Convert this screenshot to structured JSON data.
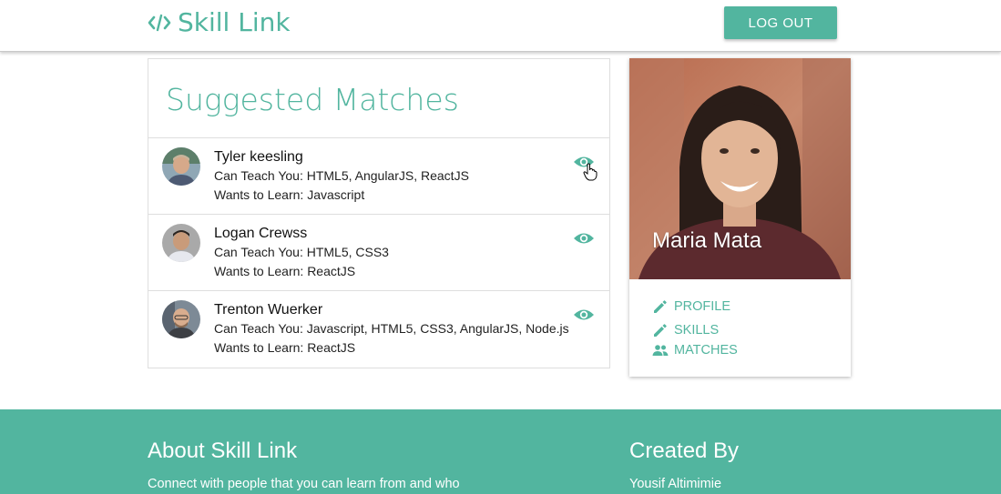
{
  "header": {
    "brand": "Skill Link",
    "logout_label": "LOG OUT"
  },
  "matches": {
    "title": "Suggested Matches",
    "items": [
      {
        "name": "Tyler keesling",
        "teach": "Can Teach You: HTML5, AngularJS, ReactJS",
        "learn": "Wants to Learn: Javascript"
      },
      {
        "name": "Logan Crewss",
        "teach": "Can Teach You: HTML5, CSS3",
        "learn": "Wants to Learn: ReactJS"
      },
      {
        "name": "Trenton Wuerker",
        "teach": "Can Teach You: Javascript, HTML5, CSS3, AngularJS, Node.js",
        "learn": "Wants to Learn: ReactJS"
      }
    ]
  },
  "profile": {
    "name": "Maria Mata",
    "links": {
      "profile": "PROFILE",
      "skills": "SKILLS",
      "matches": "MATCHES"
    }
  },
  "footer": {
    "about_title": "About Skill Link",
    "about_text": "Connect with people that you can learn from and who",
    "created_title": "Created By",
    "created_text": "Yousif Altimimie"
  },
  "colors": {
    "accent": "#52b59f",
    "text": "#222222"
  },
  "icons": [
    "code-icon",
    "eye-icon",
    "pencil-icon",
    "people-icon",
    "hand-cursor-icon"
  ]
}
